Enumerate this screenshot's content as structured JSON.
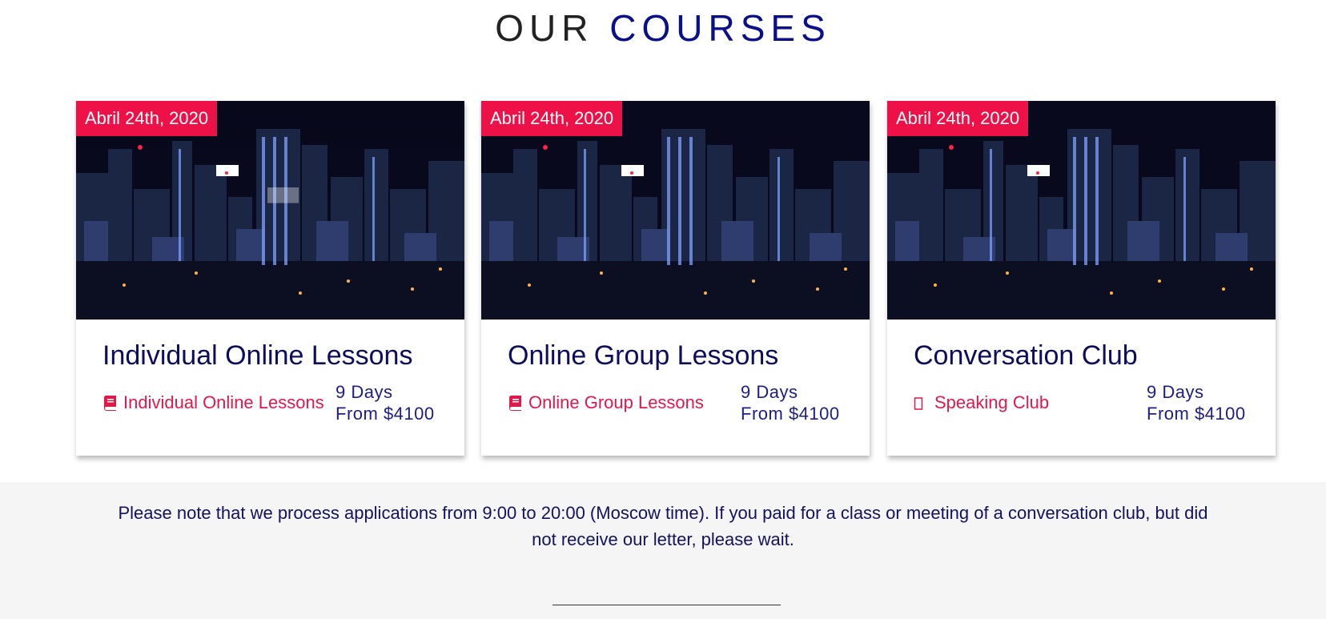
{
  "section": {
    "title_part1": "OUR",
    "title_part2": "COURSES"
  },
  "accent_color": "#ee1148",
  "courses": [
    {
      "date": "Abril 24th, 2020",
      "title": "Individual Online Lessons",
      "type_icon": "book-icon",
      "type": "Individual Online Lessons",
      "duration": "9 Days",
      "price": "From $4100"
    },
    {
      "date": "Abril 24th, 2020",
      "title": "Online Group Lessons",
      "type_icon": "book-icon",
      "type": "Online Group Lessons",
      "duration": "9 Days",
      "price": "From $4100"
    },
    {
      "date": "Abril 24th, 2020",
      "title": "Conversation Club",
      "type_icon": "missing-glyph-icon",
      "type": "Speaking Club",
      "duration": "9 Days",
      "price": "From $4100"
    }
  ],
  "notice": {
    "text": "Please note that we process applications from 9:00 to 20:00 (Moscow time). If you paid for a class or meeting of a conversation club, but did not receive our letter, please wait."
  }
}
